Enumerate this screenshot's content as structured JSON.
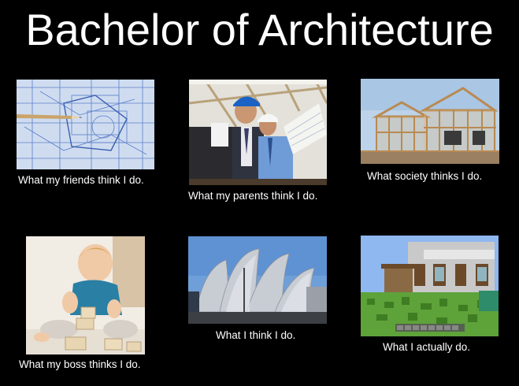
{
  "title": "Bachelor of Architecture",
  "panels": [
    {
      "caption": "What my friends think I do.",
      "image": "blueprint-image"
    },
    {
      "caption": "What my parents think I do.",
      "image": "engineers-with-hardhats-image"
    },
    {
      "caption": "What society thinks I do.",
      "image": "house-frame-construction-image"
    },
    {
      "caption": "What my boss thinks I do.",
      "image": "baby-with-blocks-image"
    },
    {
      "caption": "What I think I do.",
      "image": "modern-metallic-building-image"
    },
    {
      "caption": "What I actually do.",
      "image": "minecraft-house-image"
    }
  ]
}
